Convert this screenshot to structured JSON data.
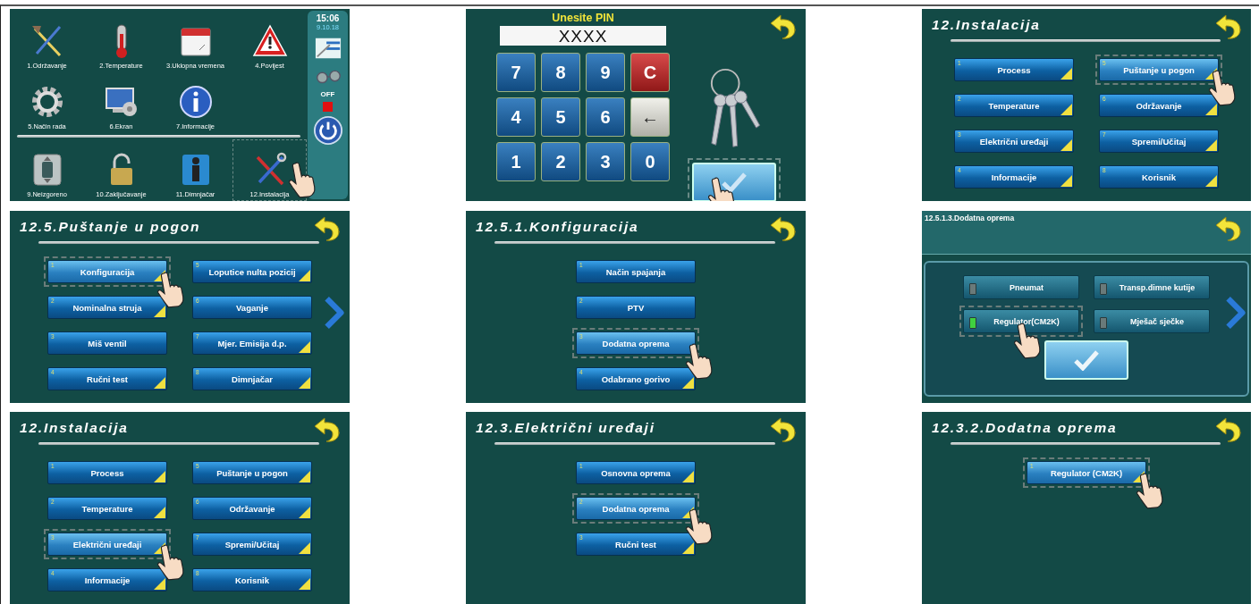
{
  "panels": [
    {
      "kind": "home",
      "time": "15:06",
      "date": "9.10.18",
      "power_label": "OFF",
      "tile_rows": [
        {
          "tiles": [
            {
              "label": "1.Održavanje",
              "selected": false
            },
            {
              "label": "2.Temperature",
              "selected": false
            },
            {
              "label": "3.Uklopna vremena",
              "selected": false
            },
            {
              "label": "4.Povijest",
              "selected": false
            }
          ]
        },
        {
          "tiles": [
            {
              "label": "5.Način rada",
              "selected": false
            },
            {
              "label": "6.Ekran",
              "selected": false
            },
            {
              "label": "7.Informacije",
              "selected": false
            }
          ]
        },
        {
          "tiles": [
            {
              "label": "9.Neizgoreno",
              "selected": false
            },
            {
              "label": "10.Zaključavanje",
              "selected": false
            },
            {
              "label": "11.Dimnjačar",
              "selected": false
            },
            {
              "label": "12.Instalacija",
              "selected": true
            }
          ]
        }
      ]
    },
    {
      "kind": "pin",
      "title": "Unesite PIN",
      "value": "XXXX",
      "confirm_selected": true,
      "keys": [
        {
          "label": "7",
          "kind": "digit"
        },
        {
          "label": "8",
          "kind": "digit"
        },
        {
          "label": "9",
          "kind": "digit"
        },
        {
          "label": "C",
          "kind": "clear"
        },
        {
          "label": "4",
          "kind": "digit"
        },
        {
          "label": "5",
          "kind": "digit"
        },
        {
          "label": "6",
          "kind": "digit"
        },
        {
          "label": "←",
          "kind": "backspace"
        },
        {
          "label": "1",
          "kind": "digit"
        },
        {
          "label": "2",
          "kind": "digit"
        },
        {
          "label": "3",
          "kind": "digit"
        },
        {
          "label": "0",
          "kind": "digit"
        }
      ]
    },
    {
      "kind": "menu",
      "title": "12.Instalacija",
      "next": false,
      "items": [
        {
          "number": "1",
          "label": "Process",
          "submenu": true,
          "selected": false
        },
        {
          "number": "2",
          "label": "Temperature",
          "submenu": true,
          "selected": false
        },
        {
          "number": "3",
          "label": "Električni uređaji",
          "submenu": true,
          "selected": false
        },
        {
          "number": "4",
          "label": "Informacije",
          "submenu": true,
          "selected": false
        },
        {
          "number": "5",
          "label": "Puštanje u pogon",
          "submenu": true,
          "selected": true
        },
        {
          "number": "6",
          "label": "Održavanje",
          "submenu": true,
          "selected": false
        },
        {
          "number": "7",
          "label": "Spremi/Učitaj",
          "submenu": true,
          "selected": false
        },
        {
          "number": "8",
          "label": "Korisnik",
          "submenu": true,
          "selected": false
        }
      ]
    },
    {
      "kind": "menu",
      "title": "12.5.Puštanje u pogon",
      "next": true,
      "items": [
        {
          "number": "1",
          "label": "Konfiguracija",
          "submenu": true,
          "selected": true
        },
        {
          "number": "2",
          "label": "Nominalna struja",
          "submenu": true,
          "selected": false
        },
        {
          "number": "3",
          "label": "Miš ventil",
          "submenu": false,
          "selected": false
        },
        {
          "number": "4",
          "label": "Ručni test",
          "submenu": true,
          "selected": false
        },
        {
          "number": "5",
          "label": "Loputice nulta pozicij",
          "submenu": true,
          "selected": false
        },
        {
          "number": "6",
          "label": "Vaganje",
          "submenu": false,
          "selected": false
        },
        {
          "number": "7",
          "label": "Mjer. Emisija d.p.",
          "submenu": true,
          "selected": false
        },
        {
          "number": "8",
          "label": "Dimnjačar",
          "submenu": true,
          "selected": false
        }
      ]
    },
    {
      "kind": "menu",
      "title": "12.5.1.Konfiguracija",
      "next": false,
      "items": [
        {
          "number": "1",
          "label": "Način spajanja",
          "submenu": false,
          "selected": false
        },
        {
          "number": "2",
          "label": "PTV",
          "submenu": false,
          "selected": false
        },
        {
          "number": "3",
          "label": "Dodatna oprema",
          "submenu": false,
          "selected": true
        },
        {
          "number": "4",
          "label": "Odabrano gorivo",
          "submenu": true,
          "selected": false
        }
      ]
    },
    {
      "kind": "options",
      "title": "12.5.1.3.Dodatna oprema",
      "next": true,
      "items": [
        {
          "label": "Pneumat",
          "checked": false,
          "selected": false
        },
        {
          "label": "Transp.dimne kutije",
          "checked": false,
          "selected": false
        },
        {
          "label": "Regulator(CM2K)",
          "checked": true,
          "selected": true
        },
        {
          "label": "Mješač sječke",
          "checked": false,
          "selected": false
        }
      ]
    },
    {
      "kind": "menu",
      "title": "12.Instalacija",
      "next": false,
      "items": [
        {
          "number": "1",
          "label": "Process",
          "submenu": true,
          "selected": false
        },
        {
          "number": "2",
          "label": "Temperature",
          "submenu": true,
          "selected": false
        },
        {
          "number": "3",
          "label": "Električni uređaji",
          "submenu": true,
          "selected": true
        },
        {
          "number": "4",
          "label": "Informacije",
          "submenu": true,
          "selected": false
        },
        {
          "number": "5",
          "label": "Puštanje u pogon",
          "submenu": true,
          "selected": false
        },
        {
          "number": "6",
          "label": "Održavanje",
          "submenu": true,
          "selected": false
        },
        {
          "number": "7",
          "label": "Spremi/Učitaj",
          "submenu": true,
          "selected": false
        },
        {
          "number": "8",
          "label": "Korisnik",
          "submenu": true,
          "selected": false
        }
      ]
    },
    {
      "kind": "menu",
      "title": "12.3.Električni uređaji",
      "next": false,
      "items": [
        {
          "number": "1",
          "label": "Osnovna oprema",
          "submenu": true,
          "selected": false
        },
        {
          "number": "2",
          "label": "Dodatna oprema",
          "submenu": true,
          "selected": true
        },
        {
          "number": "3",
          "label": "Ručni test",
          "submenu": true,
          "selected": false
        }
      ]
    },
    {
      "kind": "menu",
      "title": "12.3.2.Dodatna oprema",
      "next": false,
      "items": [
        {
          "number": "1",
          "label": "Regulator (CM2K)",
          "submenu": true,
          "selected": true
        }
      ]
    }
  ]
}
